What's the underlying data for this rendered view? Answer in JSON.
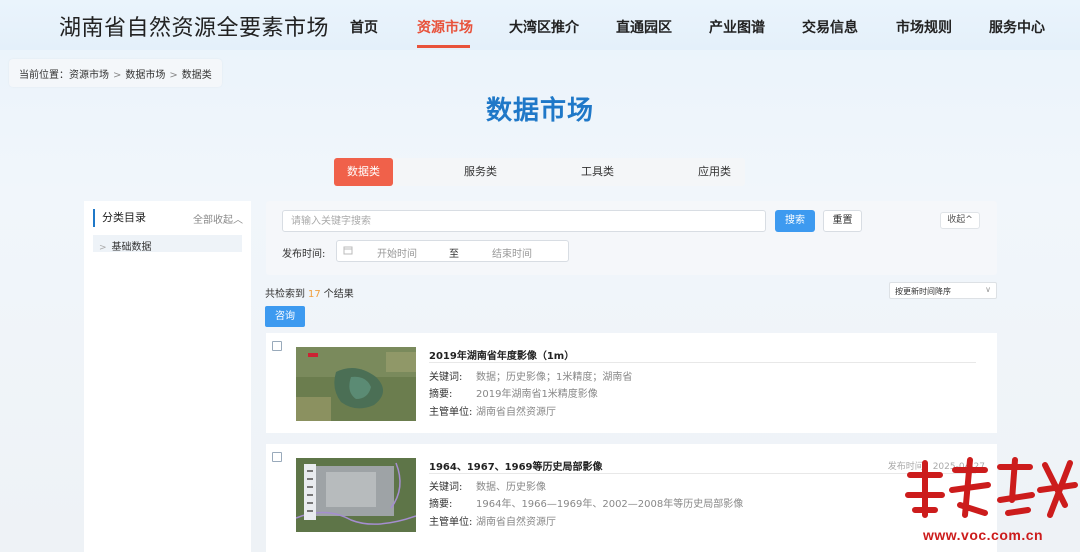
{
  "header": {
    "site_title": "湖南省自然资源全要素市场",
    "nav": [
      "首页",
      "资源市场",
      "大湾区推介",
      "直通园区",
      "产业图谱",
      "交易信息",
      "市场规则",
      "服务中心"
    ],
    "active_nav": "资源市场"
  },
  "breadcrumb": {
    "prefix": "当前位置：",
    "items": [
      "资源市场",
      "数据市场",
      "数据类"
    ],
    "separator": ">"
  },
  "page_title": "数据市场",
  "category_tabs": {
    "items": [
      "数据类",
      "服务类",
      "工具类",
      "应用类"
    ],
    "active": "数据类"
  },
  "sidebar": {
    "heading": "分类目录",
    "collapse_all": "全部收起",
    "items": [
      {
        "label": "基础数据"
      }
    ]
  },
  "search": {
    "placeholder": "请输入关键字搜索",
    "value": "",
    "search_label": "搜索",
    "reset_label": "重置",
    "fold_label": "收起",
    "date_label": "发布时间:",
    "date_start_placeholder": "开始时间",
    "date_to": "至",
    "date_end_placeholder": "结束时间"
  },
  "results": {
    "count_prefix": "共检索到",
    "count": "17",
    "count_suffix": "个结果",
    "sort_value": "按更新时间降序",
    "consult_label": "咨询"
  },
  "items": [
    {
      "title": "2019年湖南省年度影像（1m）",
      "keywords_label": "关键词:",
      "keywords": "数据；历史影像；1米精度；湖南省",
      "abstract_label": "摘要:",
      "abstract": "2019年湖南省1米精度影像",
      "org_label": "主管单位:",
      "org": "湖南省自然资源厅",
      "pubdate": ""
    },
    {
      "title": "1964、1967、1969等历史局部影像",
      "keywords_label": "关键词:",
      "keywords": "数据、历史影像",
      "abstract_label": "摘要:",
      "abstract": "1964年、1966—1969年、2002—2008年等历史局部影像",
      "org_label": "主管单位:",
      "org": "湖南省自然资源厅",
      "pubdate": "发布时间：2025-04-27"
    }
  ],
  "watermark": {
    "brand": "华声在线",
    "url": "www.voc.com.cn",
    "color": "#cc1c1c"
  },
  "colors": {
    "accent": "#e8523b",
    "title_blue": "#1f78c8",
    "button_blue": "#3d9af0",
    "count_orange": "#f0a040"
  }
}
